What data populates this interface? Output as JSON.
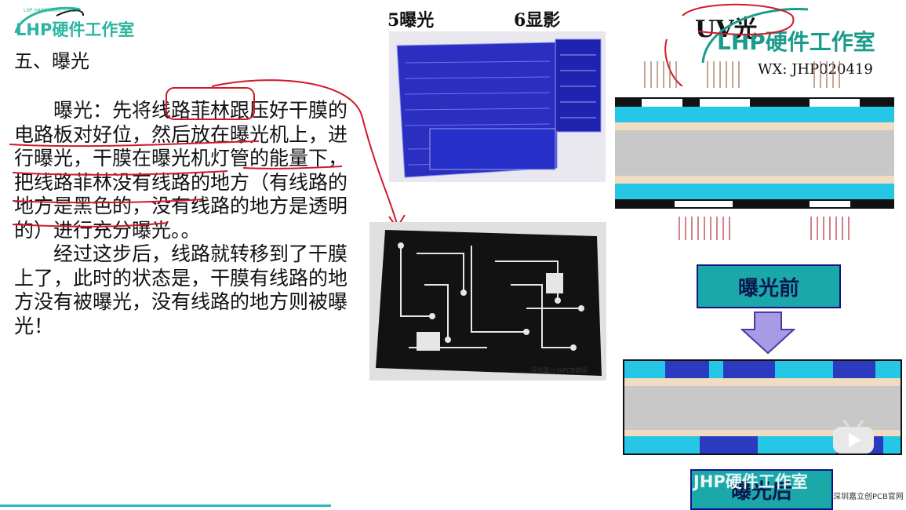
{
  "logo": {
    "name": "LHP硬件工作室",
    "subtitle": "LHP HARDWARE STUDIO"
  },
  "section_title": "五、曝光",
  "paragraph1": "曝光：先将线路菲林跟压好干膜的电路板对好位，然后放在曝光机上，进行曝光，干膜在曝光机灯管的能量下，把线路菲林没有线路的地方（有线路的地方是黑色的，没有线路的地方是透明的）进行充分曝光。。",
  "paragraph2": "经过这步后，线路就转移到了干膜上了，此时的状态是，干膜有线路的地方没有被曝光，没有线路的地方则被曝光！",
  "photo_labels": {
    "left": "5曝光",
    "right": "6显影"
  },
  "diagram": {
    "uv_label": "UV光",
    "before_label": "曝光前",
    "after_label": "曝光后"
  },
  "watermark_top": {
    "name": "LHP硬件工作室",
    "wx": "WX: JHP020419"
  },
  "watermark_bottom": {
    "name": "JHP硬件工作室",
    "source": "深圳嘉立创PCB官网"
  },
  "pcb_photo_caption": "深圳嘉立创PCB官网",
  "colors": {
    "teal": "#2bb5a0",
    "cyan": "#25c6e6",
    "blue": "#2b3bbf",
    "gray": "#c8c8c8",
    "beige": "#f0dcc0",
    "red_annotation": "#d11a2a"
  },
  "icons": [
    "video-player-icon"
  ]
}
